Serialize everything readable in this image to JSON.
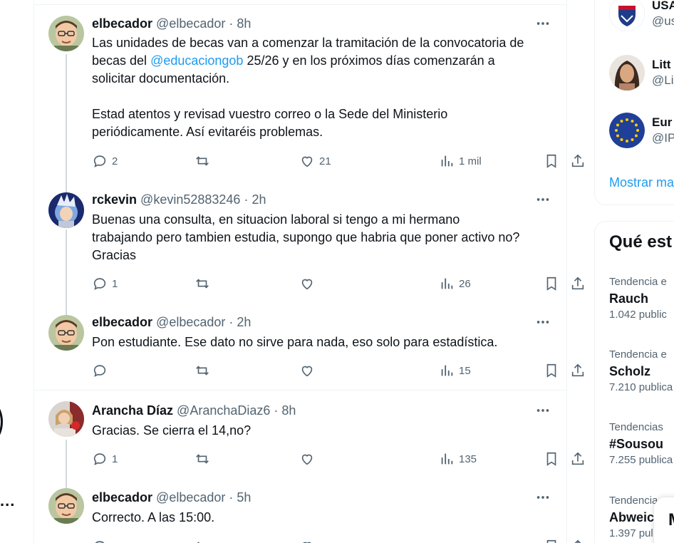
{
  "left_nav": {
    "more_label": "..."
  },
  "tweets": [
    {
      "name": "elbecador",
      "handle": "@elbecador",
      "time": "8h",
      "text_lines": [
        [
          "Las unidades de becas van a comenzar la tramitación de la convocatoria de"
        ],
        [
          "becas del ",
          "@educaciongob",
          " 25/26 y en los próximos días comenzarán a"
        ],
        [
          "solicitar documentación."
        ],
        [],
        [
          "Estad atentos y revisad vuestro correo o la Sede del Ministerio"
        ],
        [
          "periódicamente. Así evitaréis problemas."
        ]
      ],
      "mention": "@educaciongob",
      "replies": "2",
      "reposts": "",
      "likes": "21",
      "views": "1 mil"
    },
    {
      "name": "rckevin",
      "handle": "@kevin52883246",
      "time": "2h",
      "text": "Buenas una consulta, en situacion laboral si tengo a mi hermano trabajando pero tambien estudia, supongo que habria que poner activo no? Gracias",
      "text_lines": [
        "Buenas una consulta, en situacion laboral si tengo a mi hermano",
        "trabajando pero tambien estudia, supongo que habria que poner activo no?",
        "Gracias"
      ],
      "replies": "1",
      "reposts": "",
      "likes": "",
      "views": "26"
    },
    {
      "name": "elbecador",
      "handle": "@elbecador",
      "time": "2h",
      "text": "Pon estudiante. Ese dato no sirve para nada, eso solo para estadística.",
      "replies": "",
      "reposts": "",
      "likes": "",
      "views": "15"
    },
    {
      "name": "Arancha Díaz",
      "handle": "@AranchaDiaz6",
      "time": "8h",
      "text": "Gracias. Se cierra el 14,no?",
      "replies": "1",
      "reposts": "",
      "likes": "",
      "views": "135"
    },
    {
      "name": "elbecador",
      "handle": "@elbecador",
      "time": "5h",
      "text": "Correcto. A las 15:00."
    }
  ],
  "sidebar": {
    "who_to_follow": [
      {
        "name": "USA",
        "handle": "@us"
      },
      {
        "name": "Litt",
        "handle": "@Li"
      },
      {
        "name": "Eur",
        "handle": "@IP"
      }
    ],
    "show_more": "Mostrar ma",
    "trends_title": "Qué est",
    "trends": [
      {
        "context": "Tendencia e",
        "title": "Rauch",
        "count": "1.042 public"
      },
      {
        "context": "Tendencia e",
        "title": "Scholz",
        "count": "7.210 publica"
      },
      {
        "context": "Tendencias",
        "title": "#Sousou",
        "count": "7.255 publica"
      },
      {
        "context": "Tendencia",
        "title": "Abweic",
        "count": "1.397 pul"
      }
    ],
    "floating_label": "M"
  },
  "colors": {
    "accent": "#1d9bf0",
    "text": "#0f1419",
    "muted": "#536471",
    "border": "#eff3f4",
    "thread": "#cfd9de"
  }
}
